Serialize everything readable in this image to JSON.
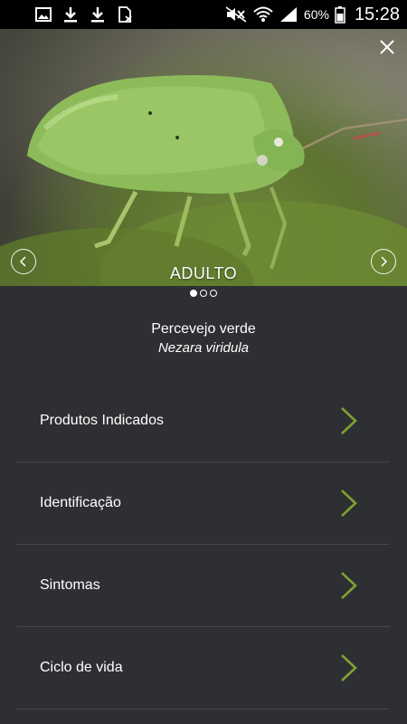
{
  "status_bar": {
    "left_icons": [
      "image-icon",
      "download-icon",
      "download-icon",
      "sim-off-icon"
    ],
    "right_icons": [
      "mute-icon",
      "wifi-icon",
      "signal-icon",
      "battery-icon"
    ],
    "battery": "60%",
    "time": "15:28"
  },
  "hero": {
    "stage_label": "ADULTO",
    "page_count": 3,
    "active_page": 1
  },
  "pest": {
    "common_name": "Percevejo verde",
    "scientific_name": "Nezara viridula"
  },
  "menu": {
    "items": [
      {
        "label": "Produtos Indicados"
      },
      {
        "label": "Identificação"
      },
      {
        "label": "Sintomas"
      },
      {
        "label": "Ciclo de vida"
      }
    ]
  },
  "colors": {
    "background": "#2e2f32",
    "divider": "#46474a",
    "accent_chevron": "#7fa232"
  }
}
